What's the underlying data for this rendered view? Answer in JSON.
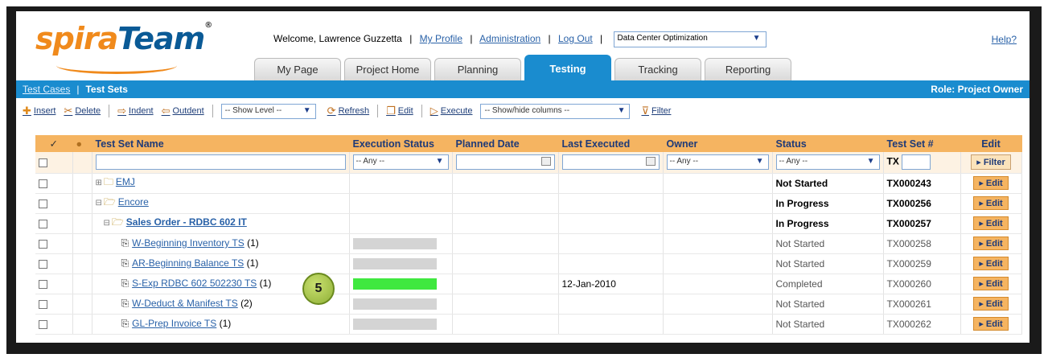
{
  "header": {
    "logo_part1": "spira",
    "logo_part2": "Team",
    "logo_tm": "®",
    "welcome_text": "Welcome, Lawrence Guzzetta",
    "my_profile": "My Profile",
    "administration": "Administration",
    "log_out": "Log Out",
    "project_select": "Data Center Optimization",
    "help": "Help?"
  },
  "tabs": [
    "My Page",
    "Project Home",
    "Planning",
    "Testing",
    "Tracking",
    "Reporting"
  ],
  "subnav": {
    "test_cases": "Test Cases",
    "separator": "|",
    "test_sets": "Test Sets",
    "role": "Role: Project Owner"
  },
  "toolbar": {
    "insert": "Insert",
    "delete": "Delete",
    "indent": "Indent",
    "outdent": "Outdent",
    "show_level": "-- Show Level --",
    "refresh": "Refresh",
    "edit": "Edit",
    "execute": "Execute",
    "show_hide_columns": "-- Show/hide columns --",
    "filter": "Filter"
  },
  "grid": {
    "columns": {
      "check": "✓",
      "name": "Test Set Name",
      "exec_status": "Execution Status",
      "planned_date": "Planned Date",
      "last_executed": "Last Executed",
      "owner": "Owner",
      "status": "Status",
      "test_set_num": "Test Set #",
      "edit": "Edit"
    },
    "filter_row": {
      "exec_any": "-- Any --",
      "owner_any": "-- Any --",
      "status_any": "-- Any --",
      "tx_prefix": "TX",
      "filter_btn": "Filter"
    },
    "rows": [
      {
        "name": "EMJ",
        "count": "",
        "last_executed": "",
        "status": "Not Started",
        "id": "TX000243",
        "edit": "Edit"
      },
      {
        "name": "Encore",
        "count": "",
        "last_executed": "",
        "status": "In Progress",
        "id": "TX000256",
        "edit": "Edit"
      },
      {
        "name": "Sales Order - RDBC 602 IT",
        "count": "",
        "last_executed": "",
        "status": "In Progress",
        "id": "TX000257",
        "edit": "Edit"
      },
      {
        "name": "W-Beginning Inventory TS",
        "count": "(1)",
        "last_executed": "",
        "status": "Not Started",
        "id": "TX000258",
        "edit": "Edit",
        "progress": 0
      },
      {
        "name": "AR-Beginning Balance TS",
        "count": "(1)",
        "last_executed": "",
        "status": "Not Started",
        "id": "TX000259",
        "edit": "Edit",
        "progress": 0
      },
      {
        "name": "S-Exp RDBC 602 502230 TS",
        "count": "(1)",
        "last_executed": "12-Jan-2010",
        "status": "Completed",
        "id": "TX000260",
        "edit": "Edit",
        "progress": 1
      },
      {
        "name": "W-Deduct & Manifest TS",
        "count": "(2)",
        "last_executed": "",
        "status": "Not Started",
        "id": "TX000261",
        "edit": "Edit",
        "progress": 0
      },
      {
        "name": "GL-Prep Invoice TS",
        "count": "(1)",
        "last_executed": "",
        "status": "Not Started",
        "id": "TX000262",
        "edit": "Edit",
        "progress": 0
      }
    ]
  },
  "callout": "5",
  "colors": {
    "accent_blue": "#1a8ccf",
    "header_orange": "#f5b461",
    "pass_green": "#3fe83f",
    "not_run_gray": "#d4d4d4"
  }
}
